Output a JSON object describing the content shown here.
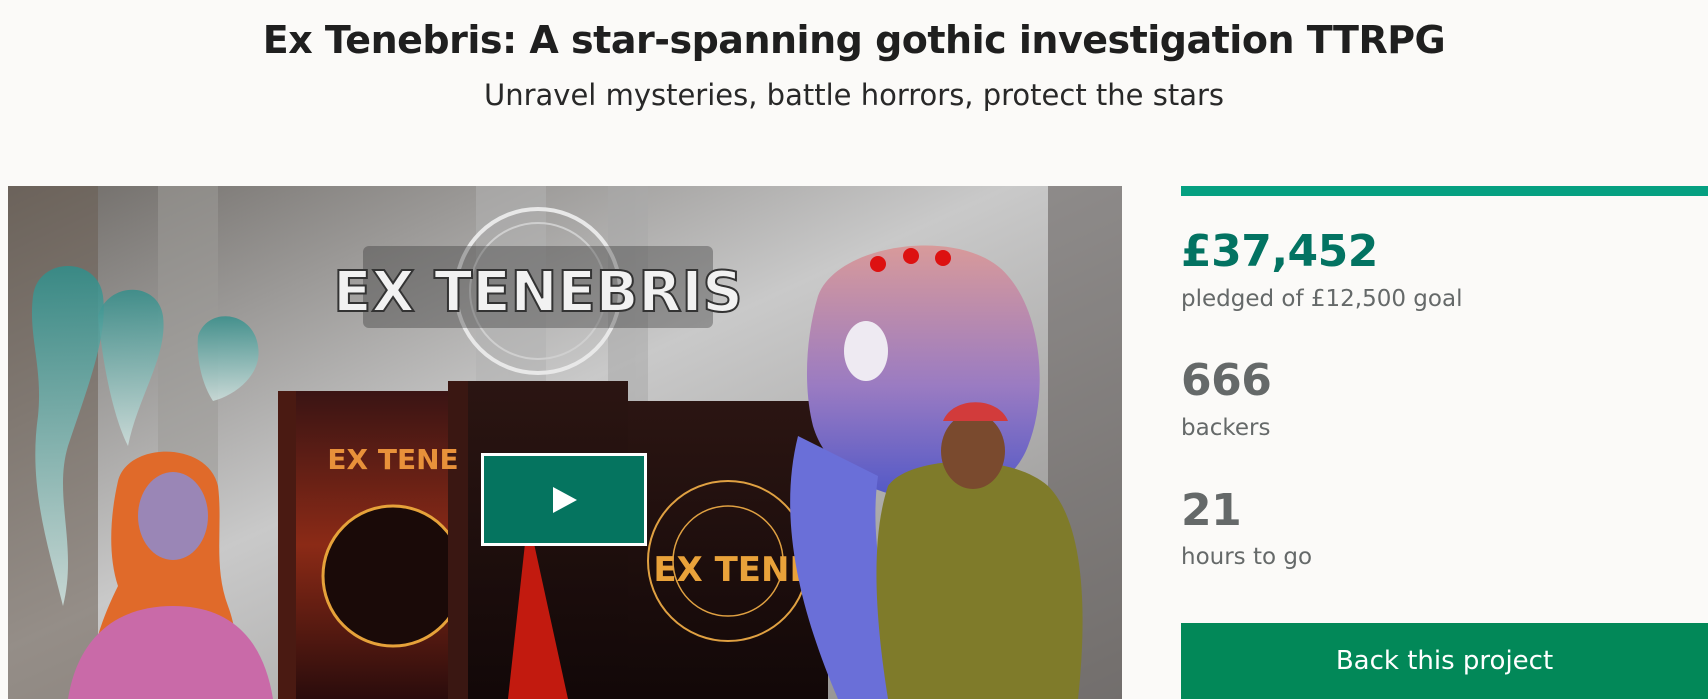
{
  "project": {
    "title": "Ex Tenebris: A star-spanning gothic investigation TTRPG",
    "subtitle": "Unravel mysteries, battle horrors, protect the stars"
  },
  "hero": {
    "logo_text": "EX TENEBRIS",
    "book_spine_text": "EX TENEBRIS",
    "book_cover_text": "EX TENE"
  },
  "stats": {
    "pledged_amount": "£37,452",
    "pledged_label": "pledged of £12,500 goal",
    "backers_count": "666",
    "backers_label": "backers",
    "time_left": "21",
    "time_label": "hours to go",
    "progress_fraction": 1.0
  },
  "actions": {
    "back_label": "Back this project"
  },
  "colors": {
    "accent_green": "#05a081",
    "pledged_text": "#037362",
    "button_green": "#028858",
    "play_button": "#05745f"
  },
  "icons": {
    "play": "play-icon"
  }
}
